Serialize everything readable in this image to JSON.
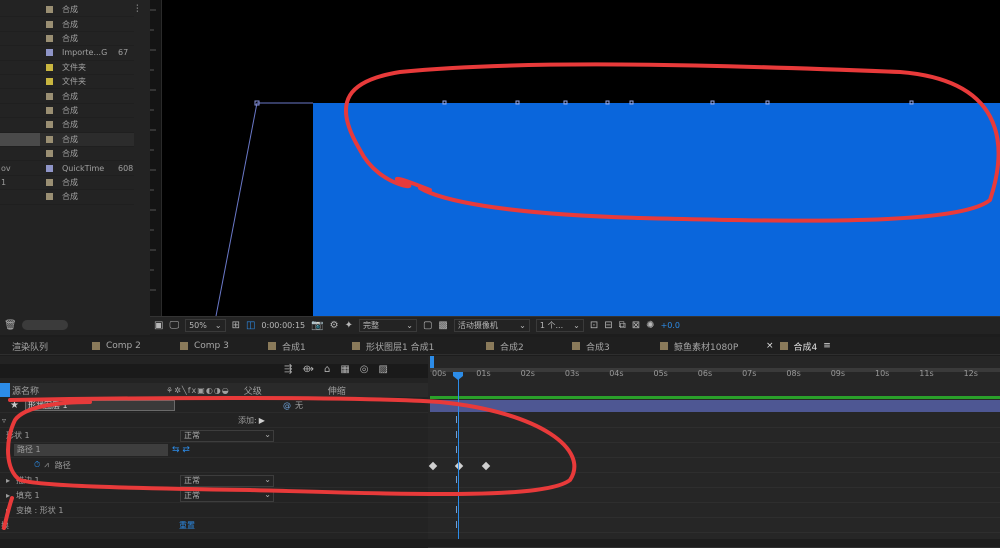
{
  "colors": {
    "accent": "#2c8ce8",
    "comp_blue": "#0a66dc",
    "annotation": "#e83a3a"
  },
  "project": {
    "items": [
      {
        "lead": "",
        "type": "合成",
        "size": "",
        "swatch": "#9a8f73"
      },
      {
        "lead": "",
        "type": "合成",
        "size": "",
        "swatch": "#9a8f73"
      },
      {
        "lead": "",
        "type": "合成",
        "size": "",
        "swatch": "#9a8f73"
      },
      {
        "lead": "",
        "type": "Importe...G",
        "size": "67",
        "swatch": "#8f95c8"
      },
      {
        "lead": "",
        "type": "文件夹",
        "size": "",
        "swatch": "#c9b640"
      },
      {
        "lead": "",
        "type": "文件夹",
        "size": "",
        "swatch": "#c9b640"
      },
      {
        "lead": "",
        "type": "合成",
        "size": "",
        "swatch": "#9a8f73"
      },
      {
        "lead": "",
        "type": "合成",
        "size": "",
        "swatch": "#9a8f73"
      },
      {
        "lead": "",
        "type": "合成",
        "size": "",
        "swatch": "#9a8f73"
      },
      {
        "lead": "",
        "type": "合成",
        "size": "",
        "swatch": "#9a8f73"
      },
      {
        "lead": "",
        "type": "合成",
        "size": "",
        "swatch": "#9a8f73"
      },
      {
        "lead": "ov",
        "type": "QuickTime",
        "size": "608",
        "swatch": "#8f95c8"
      },
      {
        "lead": "1",
        "type": "合成",
        "size": "",
        "swatch": "#9a8f73"
      },
      {
        "lead": "",
        "type": "合成",
        "size": "",
        "swatch": "#9a8f73"
      }
    ]
  },
  "viewer_bar": {
    "zoom": "50%",
    "timecode": "0:00:00:15",
    "resolution": "完整",
    "camera": "活动摄像机",
    "views": "1 个...",
    "exposure": "+0.0"
  },
  "tabs": [
    {
      "label": "渲染队列"
    },
    {
      "label": "Comp 2"
    },
    {
      "label": "Comp 3"
    },
    {
      "label": "合成1"
    },
    {
      "label": "形状图层1 合成1"
    },
    {
      "label": "合成2"
    },
    {
      "label": "合成3"
    },
    {
      "label": "鲸鱼素材1080P"
    },
    {
      "label": "合成4"
    }
  ],
  "timeline": {
    "columns": {
      "source_name": "源名称",
      "parent": "父级",
      "stretch": "伸缩"
    },
    "layer_name": "形状图层 1",
    "parent_value": "无",
    "add_label": "添加:",
    "rows": [
      {
        "label": "形状 1",
        "mode": "正常"
      },
      {
        "label": "路径 1"
      },
      {
        "label": "路径"
      },
      {
        "label": "描边 1",
        "mode": "正常"
      },
      {
        "label": "填充 1",
        "mode": "正常"
      },
      {
        "label": "变换 : 形状 1"
      },
      {
        "label": "换",
        "reset": "重置"
      }
    ],
    "ruler": [
      "00s",
      "01s",
      "02s",
      "03s",
      "04s",
      "05s",
      "06s",
      "07s",
      "08s",
      "09s",
      "10s",
      "11s",
      "12s"
    ]
  }
}
